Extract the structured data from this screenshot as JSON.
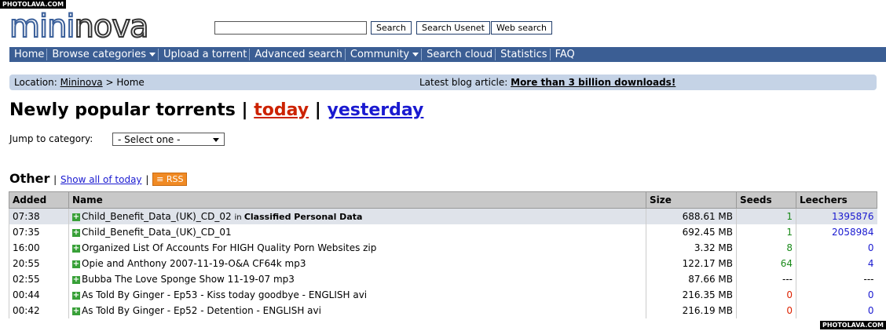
{
  "watermark": "PHOTOLAVA.COM",
  "logo": {
    "part1": "mini",
    "part2": "nova"
  },
  "search": {
    "placeholder": "",
    "buttons": [
      "Search",
      "Search Usenet",
      "Web search"
    ]
  },
  "nav": [
    {
      "label": "Home",
      "dropdown": false
    },
    {
      "label": "Browse categories",
      "dropdown": true
    },
    {
      "label": "Upload a torrent",
      "dropdown": false
    },
    {
      "label": "Advanced search",
      "dropdown": false
    },
    {
      "label": "Community",
      "dropdown": true
    },
    {
      "label": "Search cloud",
      "dropdown": false
    },
    {
      "label": "Statistics",
      "dropdown": false
    },
    {
      "label": "FAQ",
      "dropdown": false
    }
  ],
  "location": {
    "prefix": "Location: ",
    "link": "Mininova",
    "rest": " > Home",
    "blog_prefix": "Latest blog article: ",
    "blog_link": "More than 3 billion downloads!"
  },
  "heading": {
    "text": "Newly popular torrents",
    "sep": " | ",
    "today": "today",
    "yesterday": "yesterday"
  },
  "jump": {
    "label": "Jump to category:",
    "selected": "- Select one -"
  },
  "section": {
    "title": "Other",
    "show_all": "Show all of today",
    "rss": "RSS"
  },
  "table": {
    "headers": [
      "Added",
      "Name",
      "Size",
      "Seeds",
      "Leechers"
    ],
    "rows": [
      {
        "added": "07:38",
        "name": "Child_Benefit_Data_(UK)_CD_02",
        "in": "in ",
        "category": "Classified Personal Data",
        "size": "688.61 MB",
        "seeds": "1",
        "leechers": "1395876"
      },
      {
        "added": "07:35",
        "name": "Child_Benefit_Data_(UK)_CD_01",
        "in": "",
        "category": "",
        "size": "692.45 MB",
        "seeds": "1",
        "leechers": "2058984"
      },
      {
        "added": "16:00",
        "name": "Organized List Of Accounts For HIGH Quality Porn Websites zip",
        "in": "",
        "category": "",
        "size": "3.32 MB",
        "seeds": "8",
        "leechers": "0"
      },
      {
        "added": "20:55",
        "name": "Opie and Anthony 2007-11-19-O&A CF64k mp3",
        "in": "",
        "category": "",
        "size": "122.17 MB",
        "seeds": "64",
        "leechers": "4"
      },
      {
        "added": "02:55",
        "name": "Bubba The Love Sponge Show 11-19-07 mp3",
        "in": "",
        "category": "",
        "size": "87.66 MB",
        "seeds": "---",
        "leechers": "---"
      },
      {
        "added": "00:44",
        "name": "As Told By Ginger - Ep53 - Kiss today goodbye - ENGLISH avi",
        "in": "",
        "category": "",
        "size": "216.35 MB",
        "seeds": "0",
        "leechers": "0"
      },
      {
        "added": "00:42",
        "name": "As Told By Ginger - Ep52 - Detention - ENGLISH avi",
        "in": "",
        "category": "",
        "size": "216.19 MB",
        "seeds": "0",
        "leechers": "0"
      }
    ]
  },
  "colors": {
    "nav_bg": "#3b5e94",
    "location_bg": "#c5d3e6",
    "seeds_positive": "#1a8a1a",
    "seeds_zero": "#dd2200",
    "leechers": "#1a1ad0"
  }
}
